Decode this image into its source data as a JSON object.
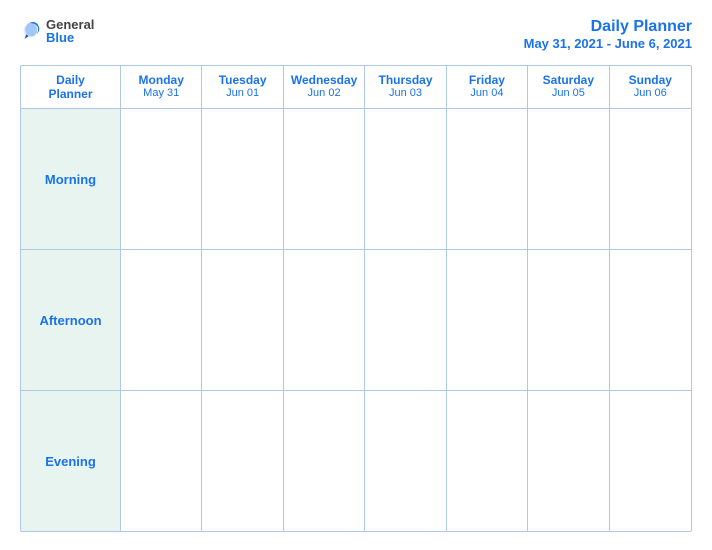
{
  "header": {
    "logo": {
      "general": "General",
      "blue": "Blue"
    },
    "title": "Daily Planner",
    "date_range": "May 31, 2021 - June 6, 2021"
  },
  "calendar": {
    "columns": [
      {
        "day": "Daily\nPlanner",
        "date": ""
      },
      {
        "day": "Monday",
        "date": "May 31"
      },
      {
        "day": "Tuesday",
        "date": "Jun 01"
      },
      {
        "day": "Wednesday",
        "date": "Jun 02"
      },
      {
        "day": "Thursday",
        "date": "Jun 03"
      },
      {
        "day": "Friday",
        "date": "Jun 04"
      },
      {
        "day": "Saturday",
        "date": "Jun 05"
      },
      {
        "day": "Sunday",
        "date": "Jun 06"
      }
    ],
    "rows": [
      {
        "label": "Morning"
      },
      {
        "label": "Afternoon"
      },
      {
        "label": "Evening"
      }
    ]
  }
}
